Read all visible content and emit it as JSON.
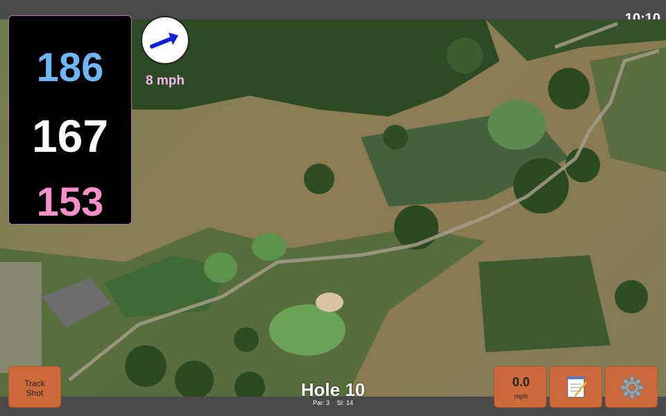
{
  "status_bar": {
    "time": "10:10"
  },
  "distances": {
    "back": "186",
    "middle": "167",
    "front": "153",
    "colors": {
      "back": "#6fb6f5",
      "middle": "#ffffff",
      "front": "#f58fc9"
    }
  },
  "wind": {
    "speed": "8 mph",
    "icon": "arrow-up-right-icon",
    "arrow_color": "#1020d8"
  },
  "hole": {
    "title": "Hole 10",
    "par_label": "Par: 3",
    "si_label": "SI: 14"
  },
  "buttons": {
    "track_shot_line1": "Track",
    "track_shot_line2": "Shot",
    "speed_value": "0.0",
    "speed_unit": "mph",
    "notes_icon": "notepad-icon",
    "settings_icon": "gear-icon"
  },
  "colors": {
    "button_bg": "#cc6a3b",
    "bar_bg": "#4a4a4a"
  }
}
